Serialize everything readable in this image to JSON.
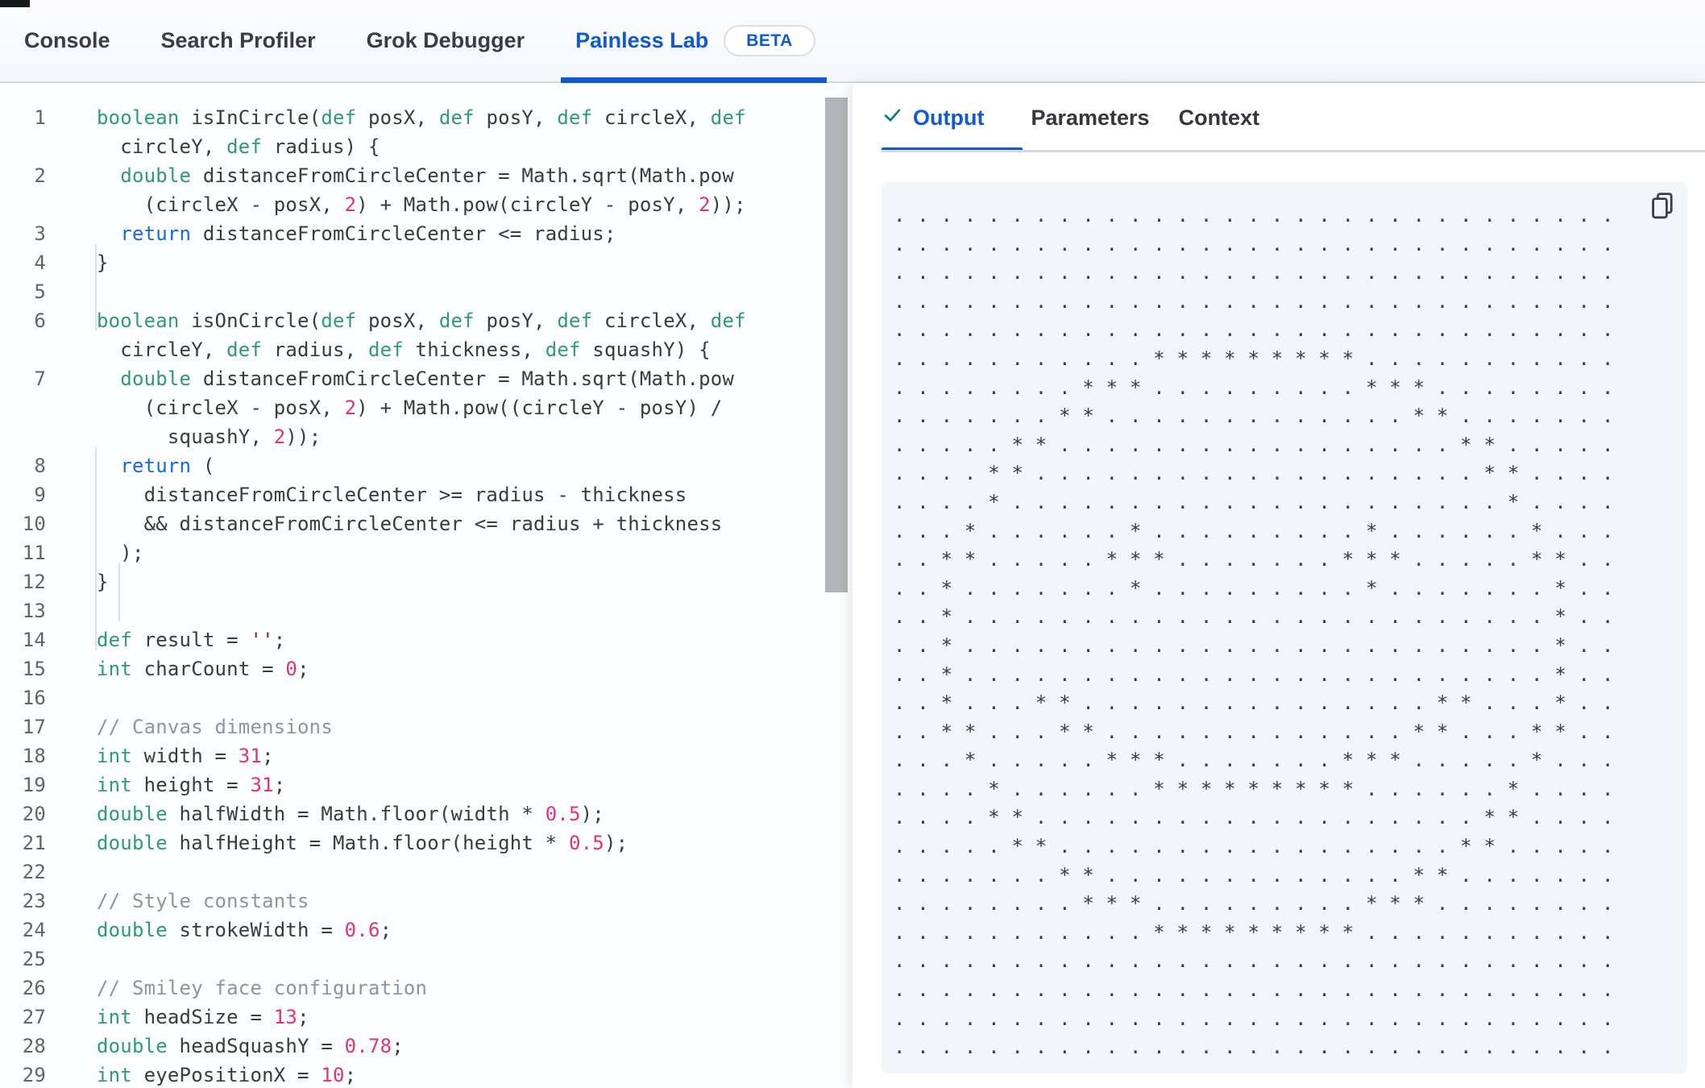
{
  "palette": {
    "accent_blue": "#1159CF",
    "tab_text": "#383D47",
    "border_gray": "#D3DAE6",
    "badge_border": "#D9DEE9",
    "editor_bg": "#FCFDFE",
    "output_panel_bg": "#F2F5F9",
    "keyword_green": "#2E9C70",
    "return_blue": "#1A67D8",
    "number_pink": "#E03476",
    "comment_gray": "#8B95A4",
    "string_red": "#A31515",
    "code_text": "#373B45",
    "line_number": "#5F6470",
    "check_teal": "#00826F",
    "scroll_thumb": "#B2B4BA"
  },
  "header": {
    "tabs": [
      {
        "label": "Console",
        "active": false
      },
      {
        "label": "Search Profiler",
        "active": false
      },
      {
        "label": "Grok Debugger",
        "active": false
      },
      {
        "label": "Painless Lab",
        "active": true
      }
    ],
    "beta_badge": "BETA"
  },
  "editor": {
    "rows": [
      {
        "n": "1",
        "toks": [
          [
            "k",
            "boolean"
          ],
          [
            "t",
            " isInCircle("
          ],
          [
            "k",
            "def"
          ],
          [
            "t",
            " posX, "
          ],
          [
            "k",
            "def"
          ],
          [
            "t",
            " posY, "
          ],
          [
            "k",
            "def"
          ],
          [
            "t",
            " circleX, "
          ],
          [
            "k",
            "def"
          ]
        ]
      },
      {
        "n": "",
        "toks": [
          [
            "t",
            "  circleY, "
          ],
          [
            "k",
            "def"
          ],
          [
            "t",
            " radius) {"
          ]
        ]
      },
      {
        "n": "2",
        "toks": [
          [
            "t",
            "  "
          ],
          [
            "k",
            "double"
          ],
          [
            "t",
            " distanceFromCircleCenter = Math.sqrt(Math.pow"
          ]
        ]
      },
      {
        "n": "",
        "toks": [
          [
            "t",
            "    (circleX - posX, "
          ],
          [
            "n",
            "2"
          ],
          [
            "t",
            ") + Math.pow(circleY - posY, "
          ],
          [
            "n",
            "2"
          ],
          [
            "t",
            "));"
          ]
        ]
      },
      {
        "n": "3",
        "toks": [
          [
            "t",
            "  "
          ],
          [
            "r",
            "return"
          ],
          [
            "t",
            " distanceFromCircleCenter <= radius;"
          ]
        ]
      },
      {
        "n": "4",
        "toks": [
          [
            "t",
            "}"
          ]
        ]
      },
      {
        "n": "5",
        "toks": []
      },
      {
        "n": "6",
        "toks": [
          [
            "k",
            "boolean"
          ],
          [
            "t",
            " isOnCircle("
          ],
          [
            "k",
            "def"
          ],
          [
            "t",
            " posX, "
          ],
          [
            "k",
            "def"
          ],
          [
            "t",
            " posY, "
          ],
          [
            "k",
            "def"
          ],
          [
            "t",
            " circleX, "
          ],
          [
            "k",
            "def"
          ]
        ]
      },
      {
        "n": "",
        "toks": [
          [
            "t",
            "  circleY, "
          ],
          [
            "k",
            "def"
          ],
          [
            "t",
            " radius, "
          ],
          [
            "k",
            "def"
          ],
          [
            "t",
            " thickness, "
          ],
          [
            "k",
            "def"
          ],
          [
            "t",
            " squashY) {"
          ]
        ]
      },
      {
        "n": "7",
        "toks": [
          [
            "t",
            "  "
          ],
          [
            "k",
            "double"
          ],
          [
            "t",
            " distanceFromCircleCenter = Math.sqrt(Math.pow"
          ]
        ]
      },
      {
        "n": "",
        "toks": [
          [
            "t",
            "    (circleX - posX, "
          ],
          [
            "n",
            "2"
          ],
          [
            "t",
            ") + Math.pow((circleY - posY) /"
          ]
        ]
      },
      {
        "n": "",
        "toks": [
          [
            "t",
            "      squashY, "
          ],
          [
            "n",
            "2"
          ],
          [
            "t",
            "));"
          ]
        ]
      },
      {
        "n": "8",
        "toks": [
          [
            "t",
            "  "
          ],
          [
            "r",
            "return"
          ],
          [
            "t",
            " ("
          ]
        ]
      },
      {
        "n": "9",
        "toks": [
          [
            "t",
            "    distanceFromCircleCenter >= radius - thickness"
          ]
        ]
      },
      {
        "n": "10",
        "toks": [
          [
            "t",
            "    && distanceFromCircleCenter <= radius + thickness"
          ]
        ]
      },
      {
        "n": "11",
        "toks": [
          [
            "t",
            "  );"
          ]
        ]
      },
      {
        "n": "12",
        "toks": [
          [
            "t",
            "}"
          ]
        ]
      },
      {
        "n": "13",
        "toks": []
      },
      {
        "n": "14",
        "toks": [
          [
            "k",
            "def"
          ],
          [
            "t",
            " result = "
          ],
          [
            "s",
            "''"
          ],
          [
            "t",
            ";"
          ]
        ]
      },
      {
        "n": "15",
        "toks": [
          [
            "k",
            "int"
          ],
          [
            "t",
            " charCount = "
          ],
          [
            "n",
            "0"
          ],
          [
            "t",
            ";"
          ]
        ]
      },
      {
        "n": "16",
        "toks": []
      },
      {
        "n": "17",
        "toks": [
          [
            "c",
            "// Canvas dimensions"
          ]
        ]
      },
      {
        "n": "18",
        "toks": [
          [
            "k",
            "int"
          ],
          [
            "t",
            " width = "
          ],
          [
            "n",
            "31"
          ],
          [
            "t",
            ";"
          ]
        ]
      },
      {
        "n": "19",
        "toks": [
          [
            "k",
            "int"
          ],
          [
            "t",
            " height = "
          ],
          [
            "n",
            "31"
          ],
          [
            "t",
            ";"
          ]
        ]
      },
      {
        "n": "20",
        "toks": [
          [
            "k",
            "double"
          ],
          [
            "t",
            " halfWidth = Math.floor(width * "
          ],
          [
            "n",
            "0.5"
          ],
          [
            "t",
            ");"
          ]
        ]
      },
      {
        "n": "21",
        "toks": [
          [
            "k",
            "double"
          ],
          [
            "t",
            " halfHeight = Math.floor(height * "
          ],
          [
            "n",
            "0.5"
          ],
          [
            "t",
            ");"
          ]
        ]
      },
      {
        "n": "22",
        "toks": []
      },
      {
        "n": "23",
        "toks": [
          [
            "c",
            "// Style constants"
          ]
        ]
      },
      {
        "n": "24",
        "toks": [
          [
            "k",
            "double"
          ],
          [
            "t",
            " strokeWidth = "
          ],
          [
            "n",
            "0.6"
          ],
          [
            "t",
            ";"
          ]
        ]
      },
      {
        "n": "25",
        "toks": []
      },
      {
        "n": "26",
        "toks": [
          [
            "c",
            "// Smiley face configuration"
          ]
        ]
      },
      {
        "n": "27",
        "toks": [
          [
            "k",
            "int"
          ],
          [
            "t",
            " headSize = "
          ],
          [
            "n",
            "13"
          ],
          [
            "t",
            ";"
          ]
        ]
      },
      {
        "n": "28",
        "toks": [
          [
            "k",
            "double"
          ],
          [
            "t",
            " headSquashY = "
          ],
          [
            "n",
            "0.78"
          ],
          [
            "t",
            ";"
          ]
        ]
      },
      {
        "n": "29",
        "toks": [
          [
            "k",
            "int"
          ],
          [
            "t",
            " eyePositionX = "
          ],
          [
            "n",
            "10"
          ],
          [
            "t",
            ";"
          ]
        ]
      }
    ]
  },
  "output_panel": {
    "tabs": [
      {
        "label": "Output",
        "active": true
      },
      {
        "label": "Parameters",
        "active": false
      },
      {
        "label": "Context",
        "active": false
      }
    ],
    "check_icon": "check-icon",
    "copy_icon": "copy-icon",
    "ascii_grid": [
      "...............................",
      "...............................",
      "...............................",
      "...............................",
      "...............................",
      "...........*********...........",
      "........***.........***........",
      ".......**.............**.......",
      ".....**.................**.....",
      "....**...................**....",
      "....*.....................*....",
      "...*......*.........*......*...",
      "..**.....***.......***.....**..",
      "..*.......*.........*.......*..",
      "..*.........................*..",
      "..*.........................*..",
      "..*.........................*..",
      "..*...**...............**...*..",
      "..**...**.............**...**..",
      "...*.....***.......***.....*...",
      "....*......*********......*....",
      "....**...................**....",
      ".....**.................**.....",
      ".......**.............**.......",
      "........***.........***........",
      "...........*********...........",
      "...............................",
      "...............................",
      "...............................",
      "..............................."
    ]
  }
}
